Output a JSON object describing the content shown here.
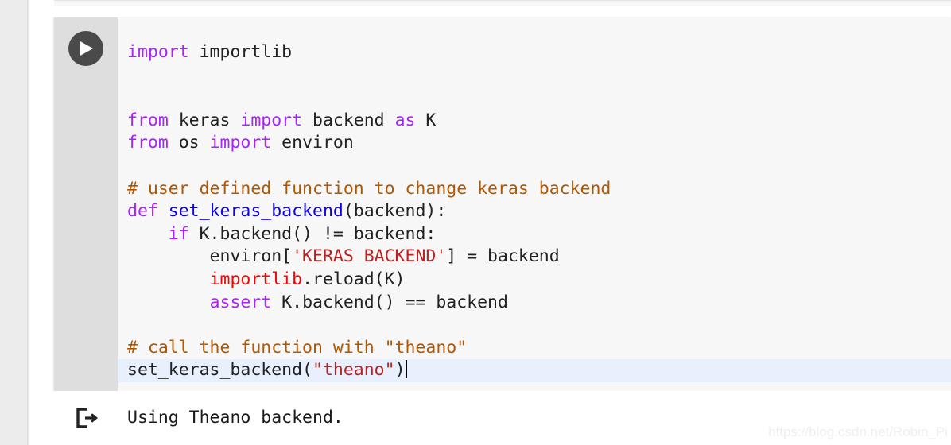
{
  "app": {
    "kind": "jupyter-notebook-code-cell",
    "watermark": "https://blog.csdn.net/Robin_Pi"
  },
  "colors": {
    "keyword": "#aa22ff",
    "comment": "#b35600",
    "string": "#ba2121",
    "function": "#0f00f0",
    "error": "#fa0000",
    "plain": "#212121",
    "cell_background": "#f7f7f7",
    "gutter_background": "#dedede",
    "active_line": "#e8f0fe",
    "run_button": "#4a4a4a",
    "page_background": "#ffffff",
    "left_rail": "#ececec"
  },
  "cell": {
    "run_button_label": "run-cell",
    "run_button_icon": "play-icon",
    "code_text": "import importlib\n\n\nfrom keras import backend as K\nfrom os import environ\n\n# user defined function to change keras backend\ndef set_keras_backend(backend):\n    if K.backend() != backend:\n        environ['KERAS_BACKEND'] = backend\n        importlib.reload(K)\n        assert K.backend() == backend\n\n# call the function with \"theano\"\nset_keras_backend(\"theano\")",
    "lines": [
      {
        "index": 0,
        "active": false,
        "tokens": [
          {
            "t": "import",
            "c": "kw"
          },
          {
            "t": " importlib",
            "c": "pln"
          }
        ]
      },
      {
        "index": 1,
        "active": false,
        "tokens": []
      },
      {
        "index": 2,
        "active": false,
        "tokens": []
      },
      {
        "index": 3,
        "active": false,
        "tokens": [
          {
            "t": "from",
            "c": "kw"
          },
          {
            "t": " keras ",
            "c": "pln"
          },
          {
            "t": "import",
            "c": "kw"
          },
          {
            "t": " backend ",
            "c": "pln"
          },
          {
            "t": "as",
            "c": "kw"
          },
          {
            "t": " K",
            "c": "pln"
          }
        ]
      },
      {
        "index": 4,
        "active": false,
        "tokens": [
          {
            "t": "from",
            "c": "kw"
          },
          {
            "t": " os ",
            "c": "pln"
          },
          {
            "t": "import",
            "c": "kw"
          },
          {
            "t": " environ",
            "c": "pln"
          }
        ]
      },
      {
        "index": 5,
        "active": false,
        "tokens": []
      },
      {
        "index": 6,
        "active": false,
        "tokens": [
          {
            "t": "# user defined function to change keras backend",
            "c": "com"
          }
        ]
      },
      {
        "index": 7,
        "active": false,
        "tokens": [
          {
            "t": "def",
            "c": "kw"
          },
          {
            "t": " ",
            "c": "pln"
          },
          {
            "t": "set_keras_backend",
            "c": "fn"
          },
          {
            "t": "(backend):",
            "c": "pln"
          }
        ]
      },
      {
        "index": 8,
        "active": false,
        "tokens": [
          {
            "t": "    ",
            "c": "pln"
          },
          {
            "t": "if",
            "c": "kw"
          },
          {
            "t": " K.backend() != backend:",
            "c": "pln"
          }
        ]
      },
      {
        "index": 9,
        "active": false,
        "tokens": [
          {
            "t": "        environ[",
            "c": "pln"
          },
          {
            "t": "'KERAS_BACKEND'",
            "c": "str"
          },
          {
            "t": "] = backend",
            "c": "pln"
          }
        ]
      },
      {
        "index": 10,
        "active": false,
        "tokens": [
          {
            "t": "        ",
            "c": "pln"
          },
          {
            "t": "importlib",
            "c": "err"
          },
          {
            "t": ".reload(K)",
            "c": "pln"
          }
        ]
      },
      {
        "index": 11,
        "active": false,
        "tokens": [
          {
            "t": "        ",
            "c": "pln"
          },
          {
            "t": "assert",
            "c": "kw"
          },
          {
            "t": " K.backend() == backend",
            "c": "pln"
          }
        ]
      },
      {
        "index": 12,
        "active": false,
        "tokens": []
      },
      {
        "index": 13,
        "active": false,
        "tokens": [
          {
            "t": "# call the function with \"theano\"",
            "c": "com"
          }
        ]
      },
      {
        "index": 14,
        "active": true,
        "caret": true,
        "tokens": [
          {
            "t": "set_keras_backend(",
            "c": "pln"
          },
          {
            "t": "\"theano\"",
            "c": "str"
          },
          {
            "t": ")",
            "c": "pln"
          }
        ]
      }
    ]
  },
  "output": {
    "icon": "output-arrow-icon",
    "text": "Using Theano backend."
  }
}
